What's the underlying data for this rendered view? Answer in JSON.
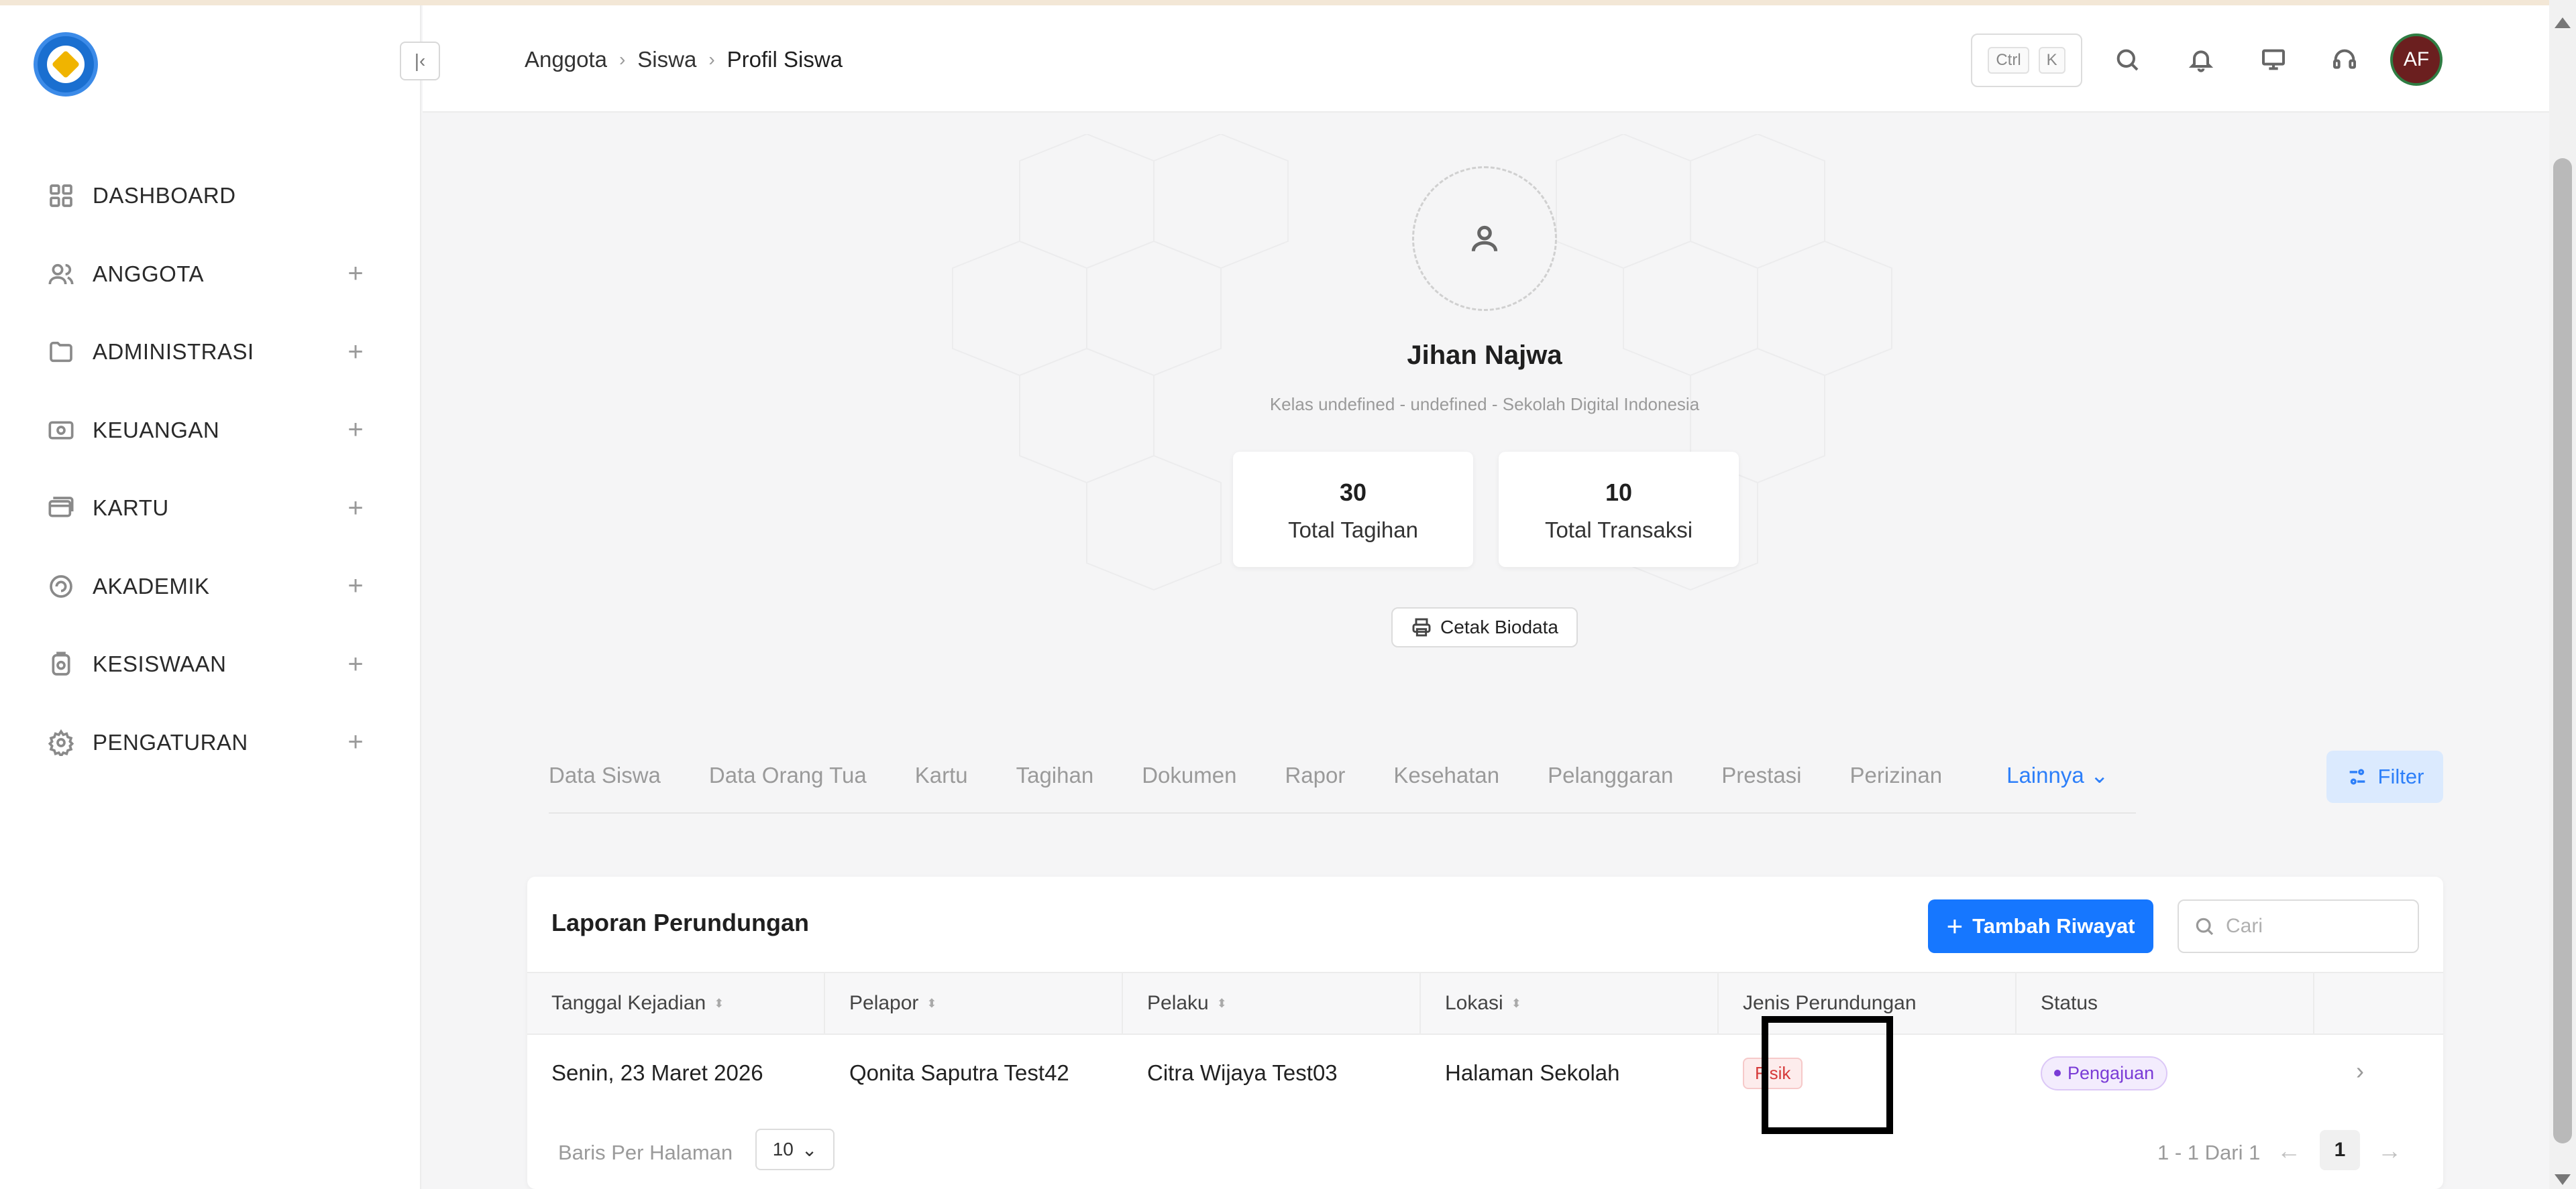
{
  "sidebar": {
    "items": [
      {
        "label": "DASHBOARD",
        "icon": "grid-icon",
        "expandable": false
      },
      {
        "label": "ANGGOTA",
        "icon": "users-icon",
        "expandable": true
      },
      {
        "label": "ADMINISTRASI",
        "icon": "folder-icon",
        "expandable": true
      },
      {
        "label": "KEUANGAN",
        "icon": "money-icon",
        "expandable": true
      },
      {
        "label": "KARTU",
        "icon": "card-icon",
        "expandable": true
      },
      {
        "label": "AKADEMIK",
        "icon": "academic-icon",
        "expandable": true
      },
      {
        "label": "KESISWAAN",
        "icon": "student-icon",
        "expandable": true
      },
      {
        "label": "PENGATURAN",
        "icon": "gear-icon",
        "expandable": true
      }
    ]
  },
  "header": {
    "breadcrumb": [
      "Anggota",
      "Siswa",
      "Profil Siswa"
    ],
    "shortcut": {
      "ctrl": "Ctrl",
      "key": "K"
    },
    "avatar_initials": "AF"
  },
  "profile": {
    "name": "Jihan Najwa",
    "subtitle": "Kelas undefined - undefined - Sekolah Digital Indonesia",
    "stats": [
      {
        "value": "30",
        "label": "Total Tagihan"
      },
      {
        "value": "10",
        "label": "Total Transaksi"
      }
    ],
    "print_label": "Cetak Biodata"
  },
  "tabs": [
    "Data Siswa",
    "Data Orang Tua",
    "Kartu",
    "Tagihan",
    "Dokumen",
    "Rapor",
    "Kesehatan",
    "Pelanggaran",
    "Prestasi",
    "Perizinan"
  ],
  "tabs_more": "Lainnya",
  "filter_label": "Filter",
  "report": {
    "title": "Laporan Perundungan",
    "add_label": "Tambah Riwayat",
    "search_placeholder": "Cari",
    "columns": [
      "Tanggal Kejadian",
      "Pelapor",
      "Pelaku",
      "Lokasi",
      "Jenis Perundungan",
      "Status"
    ],
    "rows": [
      {
        "tanggal": "Senin, 23 Maret 2026",
        "pelapor": "Qonita Saputra Test42",
        "pelaku": "Citra Wijaya Test03",
        "lokasi": "Halaman Sekolah",
        "jenis": "Fisik",
        "status": "Pengajuan"
      }
    ],
    "rows_per_page_label": "Baris Per Halaman",
    "rows_per_page": "10",
    "range": "1 - 1 Dari 1",
    "current_page": "1"
  },
  "colors": {
    "accent": "#1677ff",
    "danger": "#d63a3a",
    "status_purple": "#7a3bd6"
  }
}
